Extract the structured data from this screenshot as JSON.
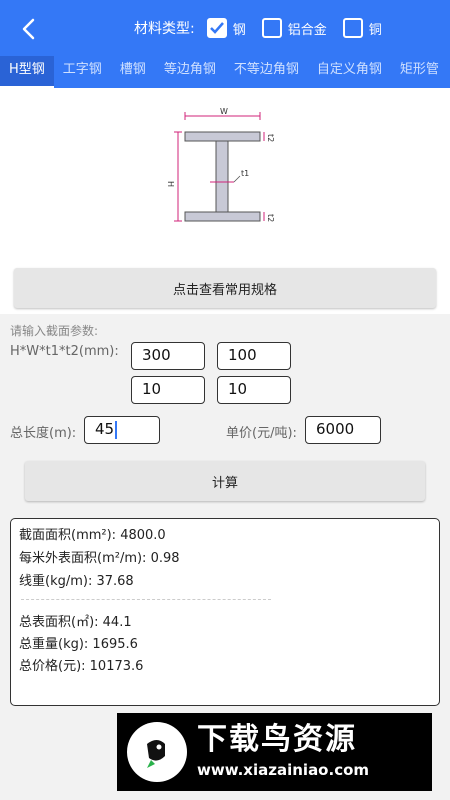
{
  "header": {
    "material_label": "材料类型:",
    "materials": [
      {
        "label": "钢",
        "checked": true
      },
      {
        "label": "铝合金",
        "checked": false
      },
      {
        "label": "铜",
        "checked": false
      }
    ],
    "tabs": [
      "H型钢",
      "工字钢",
      "槽钢",
      "等边角钢",
      "不等边角钢",
      "自定义角钢",
      "矩形管"
    ],
    "active_tab": "H型钢",
    "accent_color": "#3478f6"
  },
  "diagram": {
    "labels": {
      "w": "W",
      "h": "H",
      "t1": "t1",
      "t2_top": "t2",
      "t2_bottom": "t2"
    }
  },
  "spec_button": "点击查看常用规格",
  "form": {
    "hint": "请输入截面参数:",
    "dim_label": "H*W*t1*t2(mm):",
    "h": "300",
    "w": "100",
    "t1": "10",
    "t2": "10",
    "length_label": "总长度(m):",
    "length": "45",
    "price_label": "单价(元/吨):",
    "price": "6000"
  },
  "calc_button": "计算",
  "results": {
    "area": "截面面积(mm²): 4800.0",
    "surface_per_m": "每米外表面积(m²/m): 0.98",
    "weight_per_m": "线重(kg/m): 37.68",
    "total_surface": "总表面积(㎡): 44.1",
    "total_weight": "总重量(kg): 1695.6",
    "total_price": "总价格(元): 10173.6"
  },
  "watermark": {
    "title": "下载鸟资源",
    "url": "www.xiazainiao.com"
  }
}
